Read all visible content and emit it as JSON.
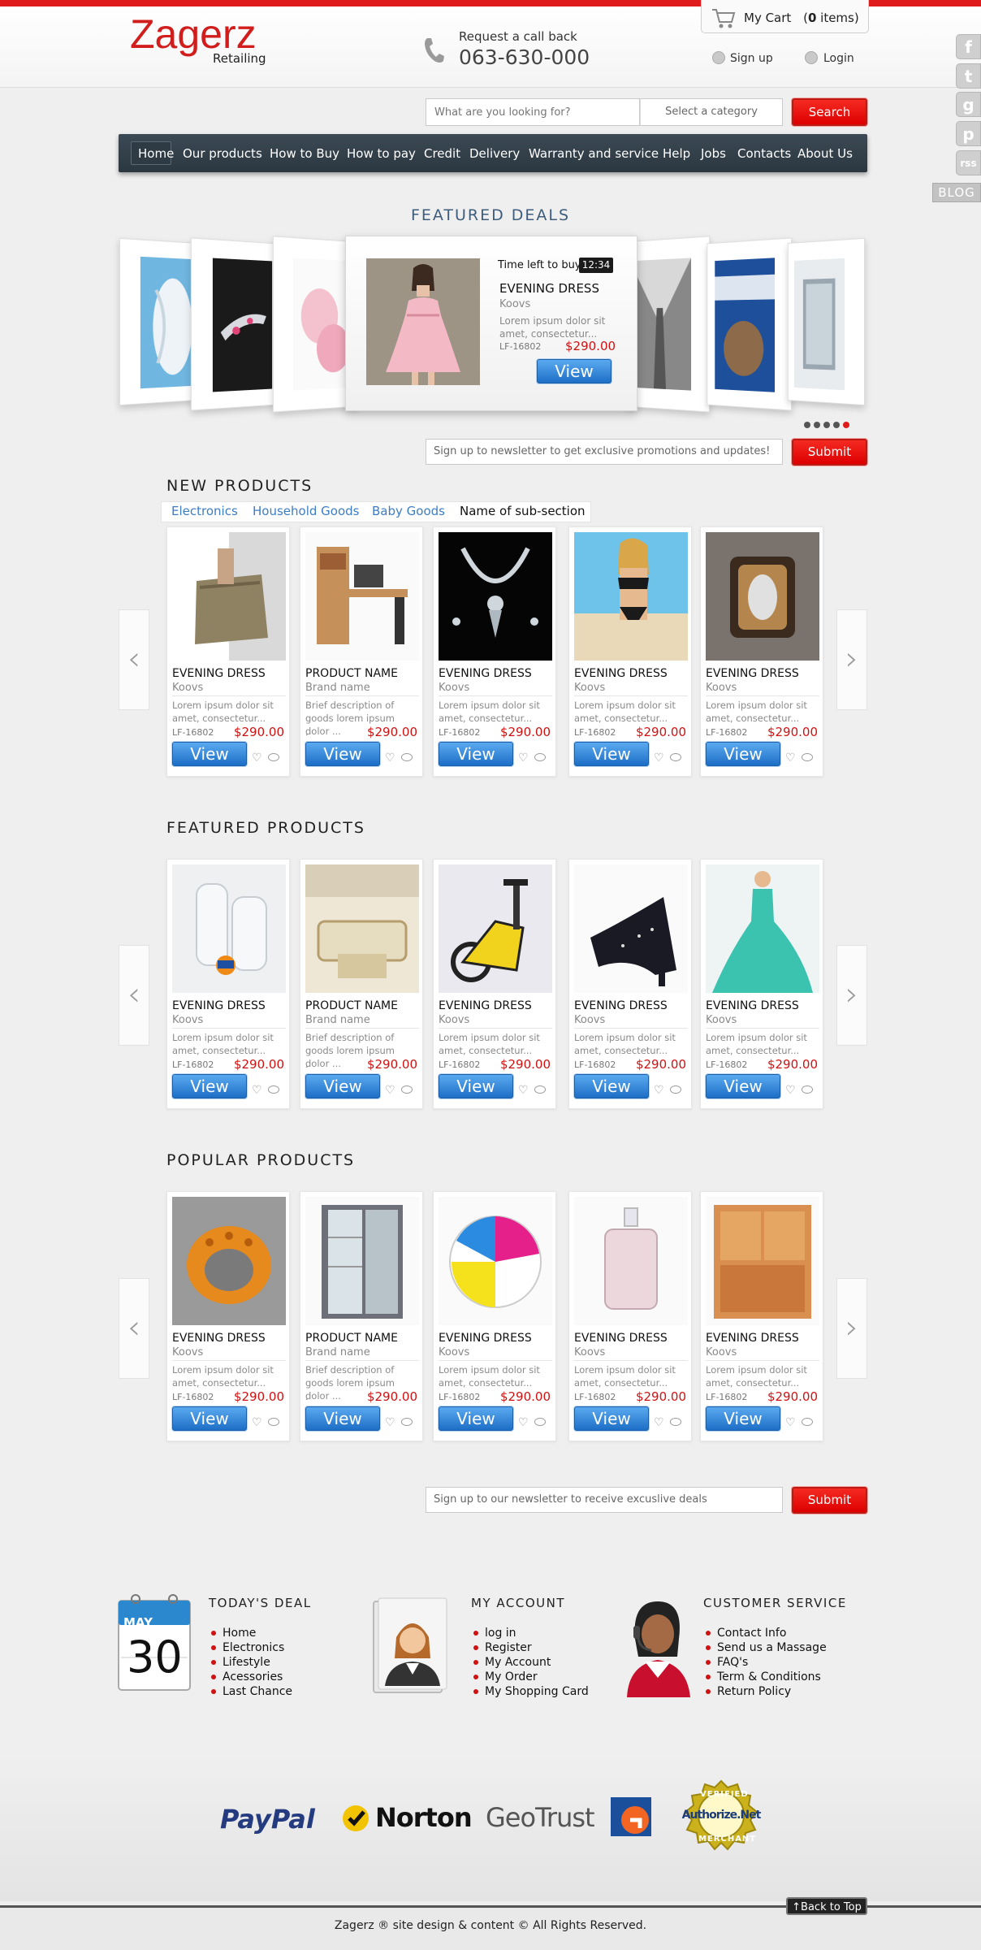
{
  "header": {
    "logo": "Zagerz",
    "logo_sub": "Retailing",
    "callback_label": "Request a call back",
    "phone": "063-630-000",
    "cart_label": "My Cart",
    "cart_count": "(0 items)",
    "cart_count_num": "0",
    "signup": "Sign up",
    "login": "Login"
  },
  "social": [
    "f",
    "t",
    "g",
    "p",
    "rss"
  ],
  "social_icons": [
    "facebook-icon",
    "twitter-icon",
    "google-plus-icon",
    "pinterest-icon",
    "rss-icon"
  ],
  "blog_tab": "BLOG",
  "search": {
    "placeholder": "What are you looking for?",
    "category": "Select a category",
    "button": "Search"
  },
  "nav": [
    "Home",
    "Our products",
    "How to Buy",
    "How to pay",
    "Credit",
    "Delivery",
    "Warranty and service",
    "Help",
    "Jobs",
    "Contacts",
    "About Us"
  ],
  "featured_deals": {
    "title": "FEATURED DEALS",
    "time_label": "Time left to buy:",
    "time": "12:34",
    "name": "EVENING DRESS",
    "brand": "Koovs",
    "desc": "Lorem ipsum dolor sit amet, consectetur...",
    "sku": "LF-16802",
    "price": "$290.00",
    "button": "View"
  },
  "newsletter_top": {
    "placeholder": "Sign up to newsletter to get exclusive promotions and updates!",
    "button": "Submit"
  },
  "newsletter_bottom": {
    "placeholder": "Sign up to our  newsletter to receive excuslive deals",
    "button": "Submit"
  },
  "new_products": {
    "title": "NEW PRODUCTS",
    "subtabs": [
      "Electronics",
      "Household Goods",
      "Baby Goods",
      "Name of sub-section"
    ],
    "items": [
      {
        "name": "EVENING DRESS",
        "brand": "Koovs",
        "desc": "Lorem ipsum dolor sit amet, consectetur...",
        "sku": "LF-16802",
        "price": "$290.00",
        "button": "View"
      },
      {
        "name": "PRODUCT NAME",
        "brand": "Brand name",
        "desc": "Brief description of goods lorem ipsum dolor ...",
        "sku": ".",
        "price": "$290.00",
        "button": "View"
      },
      {
        "name": "EVENING DRESS",
        "brand": "Koovs",
        "desc": "Lorem ipsum dolor sit amet, consectetur...",
        "sku": "LF-16802",
        "price": "$290.00",
        "button": "View"
      },
      {
        "name": "EVENING DRESS",
        "brand": "Koovs",
        "desc": "Lorem ipsum dolor sit amet, consectetur...",
        "sku": "LF-16802",
        "price": "$290.00",
        "button": "View"
      },
      {
        "name": "EVENING DRESS",
        "brand": "Koovs",
        "desc": "Lorem ipsum dolor sit amet, consectetur...",
        "sku": "LF-16802",
        "price": "$290.00",
        "button": "View"
      }
    ]
  },
  "featured_products": {
    "title": "FEATURED PRODUCTS",
    "items": [
      {
        "name": "EVENING DRESS",
        "brand": "Koovs",
        "desc": "Lorem ipsum dolor sit amet, consectetur...",
        "sku": "LF-16802",
        "price": "$290.00",
        "button": "View"
      },
      {
        "name": "PRODUCT NAME",
        "brand": "Brand name",
        "desc": "Brief description of goods lorem ipsum dolor ...",
        "sku": ".",
        "price": "$290.00",
        "button": "View"
      },
      {
        "name": "EVENING DRESS",
        "brand": "Koovs",
        "desc": "Lorem ipsum dolor sit amet, consectetur...",
        "sku": "LF-16802",
        "price": "$290.00",
        "button": "View"
      },
      {
        "name": "EVENING DRESS",
        "brand": "Koovs",
        "desc": "Lorem ipsum dolor sit amet, consectetur...",
        "sku": "LF-16802",
        "price": "$290.00",
        "button": "View"
      },
      {
        "name": "EVENING DRESS",
        "brand": "Koovs",
        "desc": "Lorem ipsum dolor sit amet, consectetur...",
        "sku": "LF-16802",
        "price": "$290.00",
        "button": "View"
      }
    ]
  },
  "popular_products": {
    "title": "POPULAR PRODUCTS",
    "items": [
      {
        "name": "EVENING DRESS",
        "brand": "Koovs",
        "desc": "Lorem ipsum dolor sit amet, consectetur...",
        "sku": "LF-16802",
        "price": "$290.00",
        "button": "View"
      },
      {
        "name": "PRODUCT NAME",
        "brand": "Brand name",
        "desc": "Brief description of goods lorem ipsum dolor ...",
        "sku": ".",
        "price": "$290.00",
        "button": "View"
      },
      {
        "name": "EVENING DRESS",
        "brand": "Koovs",
        "desc": "Lorem ipsum dolor sit amet, consectetur...",
        "sku": "LF-16802",
        "price": "$290.00",
        "button": "View"
      },
      {
        "name": "EVENING DRESS",
        "brand": "Koovs",
        "desc": "Lorem ipsum dolor sit amet, consectetur...",
        "sku": "LF-16802",
        "price": "$290.00",
        "button": "View"
      },
      {
        "name": "EVENING DRESS",
        "brand": "Koovs",
        "desc": "Lorem ipsum dolor sit amet, consectetur...",
        "sku": "LF-16802",
        "price": "$290.00",
        "button": "View"
      }
    ]
  },
  "footer": {
    "todays_deal": {
      "title": "TODAY'S DEAL",
      "calendar_month": "MAY",
      "calendar_day": "30",
      "links": [
        "Home",
        "Electronics",
        "Lifestyle",
        "Acessories",
        "Last Chance"
      ]
    },
    "my_account": {
      "title": "MY ACCOUNT",
      "links": [
        "log in",
        "Register",
        "My Account",
        "My Order",
        "My Shopping Card"
      ]
    },
    "customer_service": {
      "title": "CUSTOMER SERVICE",
      "links": [
        "Contact Info",
        "Send us a Massage",
        "FAQ's",
        "Term & Conditions",
        "Return Policy"
      ]
    }
  },
  "payment_logos": [
    "PayPal",
    "Norton",
    "GeoTrust",
    "Authorize.Net"
  ],
  "authorize_seal": {
    "top": "VERIFIED",
    "bottom": "MERCHANT"
  },
  "back_to_top": "Back to Top",
  "copyright": "Zagerz ® site design & content © All Rights Reserved.",
  "colors": {
    "accent_red": "#e01b1b",
    "nav_bg": "#333f48",
    "view_blue": "#2b7fd6",
    "price_red": "#d01111"
  }
}
